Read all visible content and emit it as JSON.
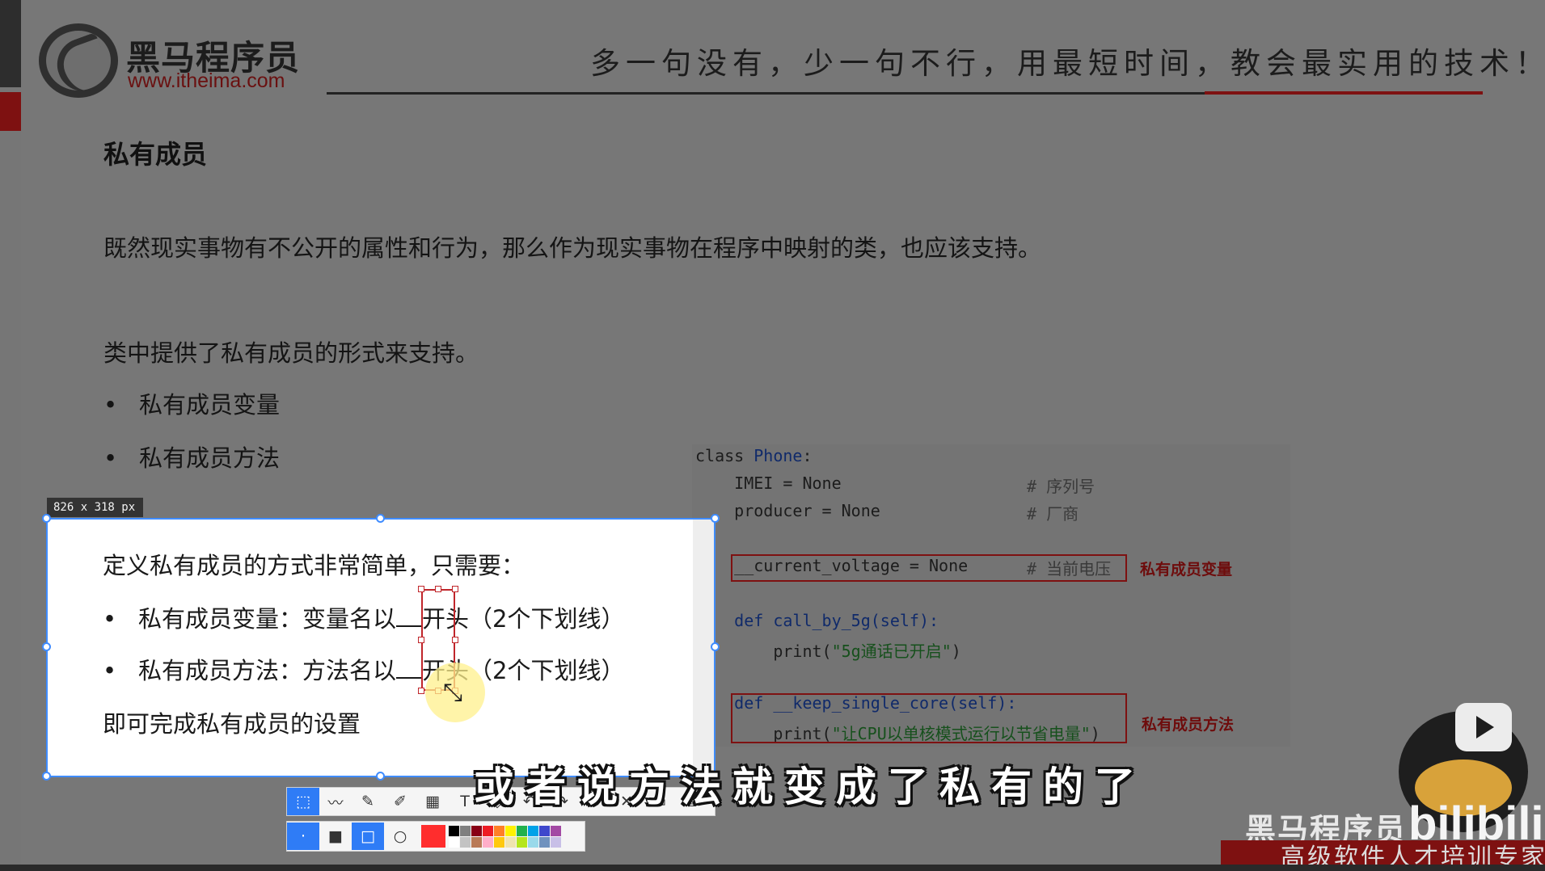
{
  "brand": {
    "name": "黑马程序员",
    "url": "www.itheima.com"
  },
  "slogan": "多一句没有，少一句不行，用最短时间，教会最实用的技术！",
  "slide": {
    "title": "私有成员",
    "para1": "既然现实事物有不公开的属性和行为，那么作为现实事物在程序中映射的类，也应该支持。",
    "para2": "类中提供了私有成员的形式来支持。",
    "bullets": [
      "私有成员变量",
      "私有成员方法"
    ],
    "bullet_mark": "•"
  },
  "code": {
    "l1_kw": "class",
    "l1_name": "Phone",
    "l1_colon": ":",
    "l2": "    IMEI = None",
    "l2_cm": "# 序列号",
    "l3": "    producer = None",
    "l3_cm": "# 厂商",
    "l4": "    __current_voltage = None",
    "l4_cm": "# 当前电压",
    "l5_kw": "    def",
    "l5": " call_by_5g(self):",
    "l6": "        print(",
    "l6_str": "\"5g通话已开启\"",
    "l6_end": ")",
    "l7_kw": "    def",
    "l7": " __keep_single_core(self):",
    "l8": "        print(",
    "l8_str": "\"让CPU以单核模式运行以节省电量\"",
    "l8_end": ")"
  },
  "annotations": {
    "var": "私有成员变量",
    "method": "私有成员方法"
  },
  "selection": {
    "size_label": "826 x 318  px",
    "line1": "定义私有成员的方式非常简单，只需要：",
    "b1_pre": "私有成员变量：变量名以",
    "b1_post": "开头（2个下划线）",
    "b2_pre": "私有成员方法：方法名以",
    "b2_post": "开头（2个下划线）",
    "line4": "即可完成私有成员的设置"
  },
  "toolbar": {
    "tools": [
      "select-tool",
      "line-tool",
      "pencil-tool",
      "marker-tool",
      "mosaic-tool",
      "text-tool",
      "eraser-tool",
      "undo-tool",
      "redo-tool",
      "close-tool",
      "pin-tool",
      "save-tool",
      "copy-tool"
    ],
    "main_color": "#ff2d2d",
    "palette": [
      "#000000",
      "#7f7f7f",
      "#880015",
      "#ed1c24",
      "#ff7f27",
      "#fff200",
      "#22b14c",
      "#00a2e8",
      "#3f48cc",
      "#a349a4",
      "#ffffff",
      "#c3c3c3",
      "#b97a57",
      "#ffaec9",
      "#ffc90e",
      "#efe4b0",
      "#b5e61d",
      "#99d9ea",
      "#7092be",
      "#c8bfe7"
    ]
  },
  "subtitle": "或者说方法就变成了私有的了",
  "watermark": {
    "name": "黑马程序员",
    "platform": "bilibili",
    "slogan": "高级软件人才培训专家"
  }
}
